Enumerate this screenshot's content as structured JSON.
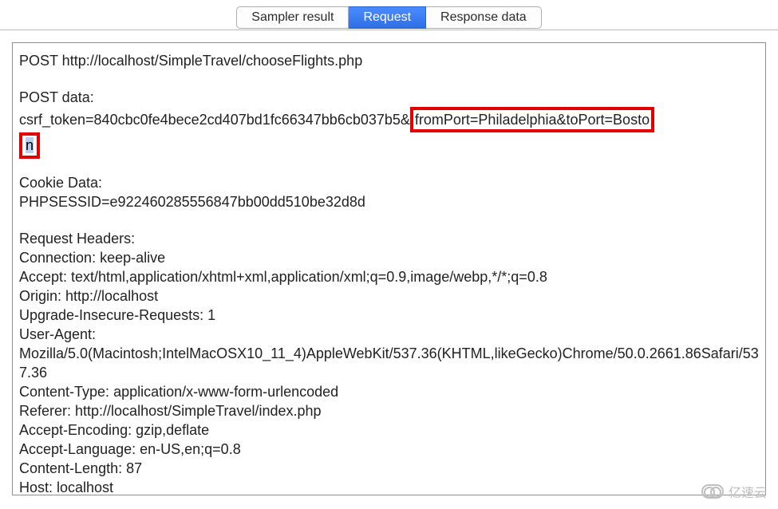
{
  "tabs": {
    "sampler": "Sampler result",
    "request": "Request",
    "response": "Response data"
  },
  "request": {
    "first_line": "POST http://localhost/SimpleTravel/chooseFlights.php",
    "post_data_label": "POST data:",
    "post_prefix": "csrf_token=840cbc0fe4bece2cd407bd1fc66347bb6cb037b5&",
    "post_hl_line1": "fromPort=Philadelphia&toPort=Bosto",
    "post_hl_line2": "n",
    "cookie_label": "Cookie Data:",
    "cookie_line": "PHPSESSID=e922460285556847bb00dd510be32d8d",
    "headers_label": "Request Headers:",
    "h_connection": "Connection: keep-alive",
    "h_accept": "Accept: text/html,application/xhtml+xml,application/xml;q=0.9,image/webp,*/*;q=0.8",
    "h_origin": "Origin: http://localhost",
    "h_upgrade": "Upgrade-Insecure-Requests: 1",
    "h_ua_label": "User-Agent:",
    "h_ua_value": "Mozilla/5.0(Macintosh;IntelMacOSX10_11_4)AppleWebKit/537.36(KHTML,likeGecko)Chrome/50.0.2661.86Safari/537.36",
    "h_ct": "Content-Type: application/x-www-form-urlencoded",
    "h_referer": "Referer: http://localhost/SimpleTravel/index.php",
    "h_enc": "Accept-Encoding: gzip,deflate",
    "h_lang": "Accept-Language: en-US,en;q=0.8",
    "h_len": "Content-Length: 87",
    "h_host": "Host: localhost"
  },
  "watermark": "亿速云"
}
